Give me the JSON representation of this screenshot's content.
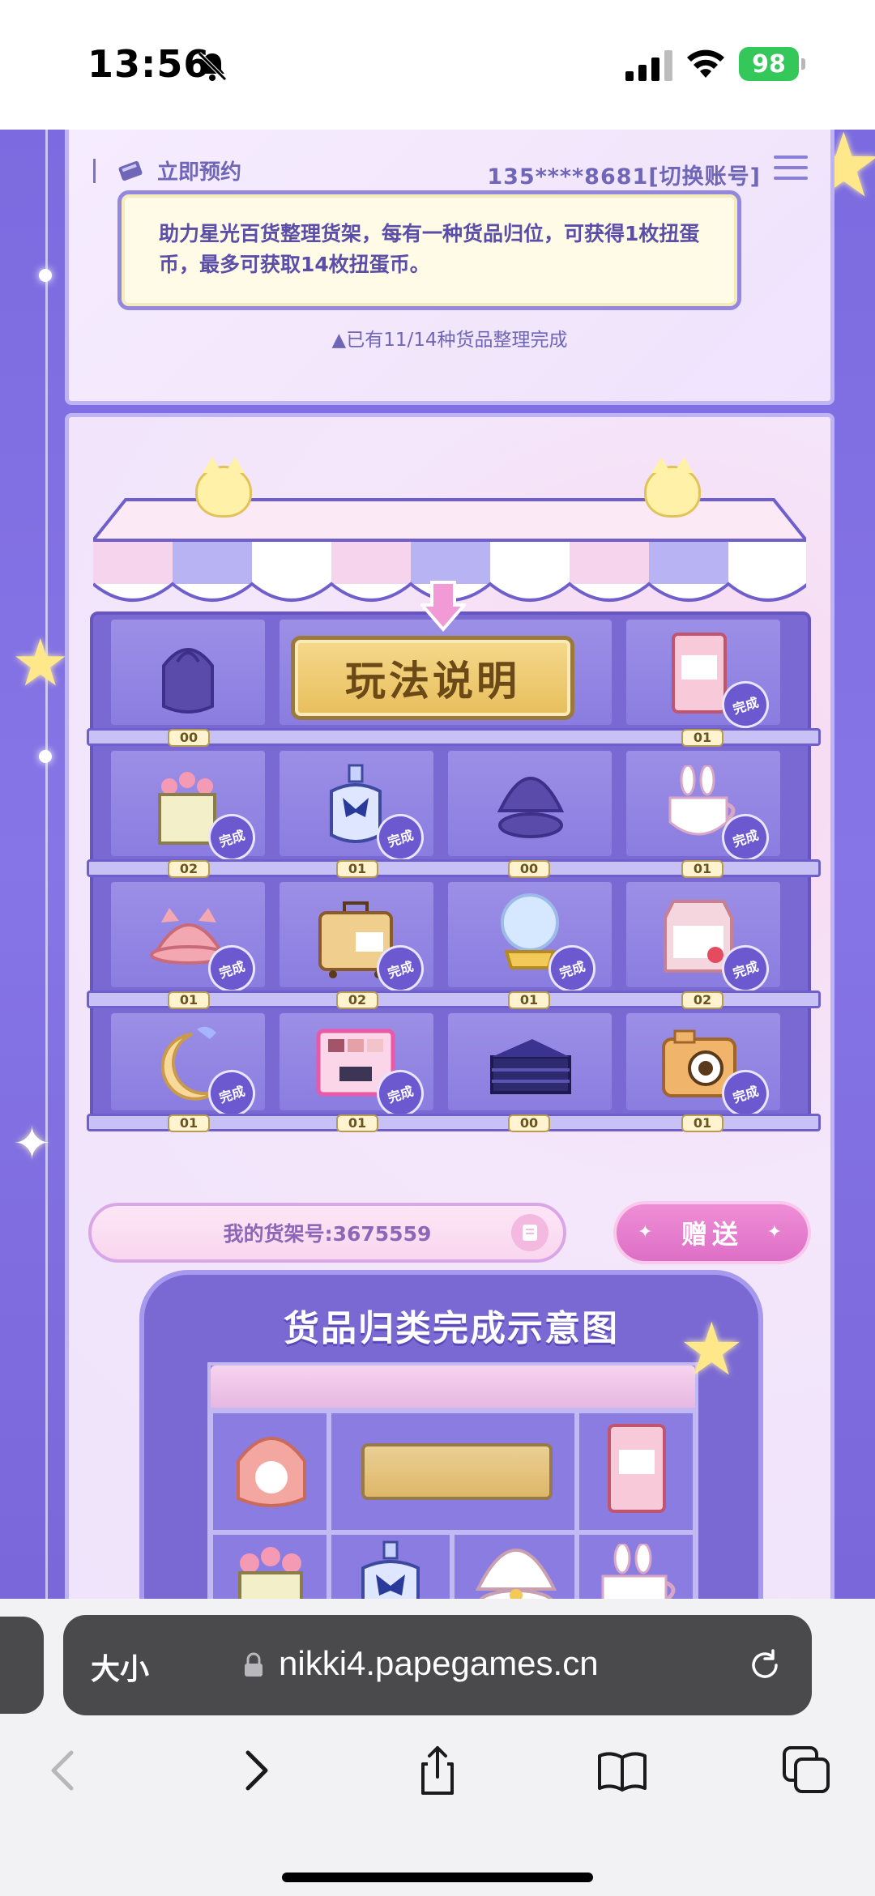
{
  "status_bar": {
    "time": "13:56",
    "battery": "98"
  },
  "header": {
    "preorder_label": "立即预约",
    "account": "135****8681[切换账号]"
  },
  "notice": {
    "text": "助力星光百货整理货架，每有一种货品归位，可获得1枚扭蛋币，最多可获取14枚扭蛋币。",
    "progress": "▲已有11/14种货品整理完成"
  },
  "shelf": {
    "rules_button": "玩法说明",
    "done_label": "完成",
    "cells": [
      {
        "item": "backpack-icon",
        "count": "00",
        "done": false
      },
      {
        "item": "rules",
        "count": "",
        "done": false
      },
      {
        "item": "photo-album-icon",
        "count": "01",
        "done": true
      },
      {
        "item": "flower-basket-icon",
        "count": "02",
        "done": true
      },
      {
        "item": "perfume-icon",
        "count": "01",
        "done": true
      },
      {
        "item": "shell-icon",
        "count": "00",
        "done": false
      },
      {
        "item": "bunny-mug-icon",
        "count": "01",
        "done": true
      },
      {
        "item": "cat-hat-icon",
        "count": "01",
        "done": true
      },
      {
        "item": "suitcase-icon",
        "count": "02",
        "done": true
      },
      {
        "item": "crystal-ball-icon",
        "count": "01",
        "done": true
      },
      {
        "item": "milk-carton-icon",
        "count": "02",
        "done": true
      },
      {
        "item": "moon-pillow-icon",
        "count": "01",
        "done": true
      },
      {
        "item": "eyeshadow-palette-icon",
        "count": "01",
        "done": true
      },
      {
        "item": "cake-icon",
        "count": "00",
        "done": false
      },
      {
        "item": "camera-icon",
        "count": "01",
        "done": true
      }
    ]
  },
  "shelf_id": {
    "label": "我的货架号:3675559"
  },
  "gift_button": {
    "label": "赠送"
  },
  "sample": {
    "title": "货品归类完成示意图"
  },
  "safari": {
    "text_size": "大小",
    "url": "nikki4.papegames.cn"
  },
  "colors": {
    "accent": "#7a69d3",
    "panel": "#f4e6fb",
    "gold": "#e8be5c",
    "pink": "#dd6fc6"
  }
}
